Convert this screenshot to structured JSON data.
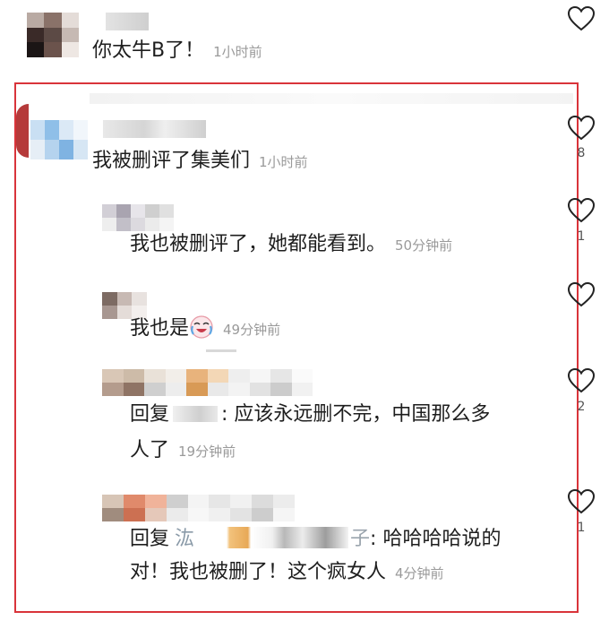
{
  "comments": [
    {
      "text": "你太牛B了！",
      "time": "1小时前"
    },
    {
      "text": "我被删评了集美们",
      "time": "1小时前",
      "likes": "8"
    }
  ],
  "replies": [
    {
      "text": "我也被删评了，她都能看到。",
      "time": "50分钟前",
      "likes": "1"
    },
    {
      "text": "我也是",
      "time": "49分钟前",
      "likes": ""
    },
    {
      "prefix": "回复",
      "line1": ": 应该永远删不完，中国那么多",
      "line2": "人了",
      "time": "19分钟前",
      "likes": "2"
    },
    {
      "prefix": "回复",
      "partial_name_a": "汯",
      "partial_name_b": "子",
      "line1": ": 哈哈哈哈说的",
      "line2": "对！我也被删了！这个疯女人",
      "time": "4分钟前",
      "likes": "1"
    }
  ],
  "icons": {
    "like": "heart-outline-icon",
    "emoji": "crying-laughing-emoji-icon"
  },
  "colors": {
    "highlight": "#d9343a",
    "text": "#1e1e1e",
    "muted": "#9a9a9a"
  }
}
